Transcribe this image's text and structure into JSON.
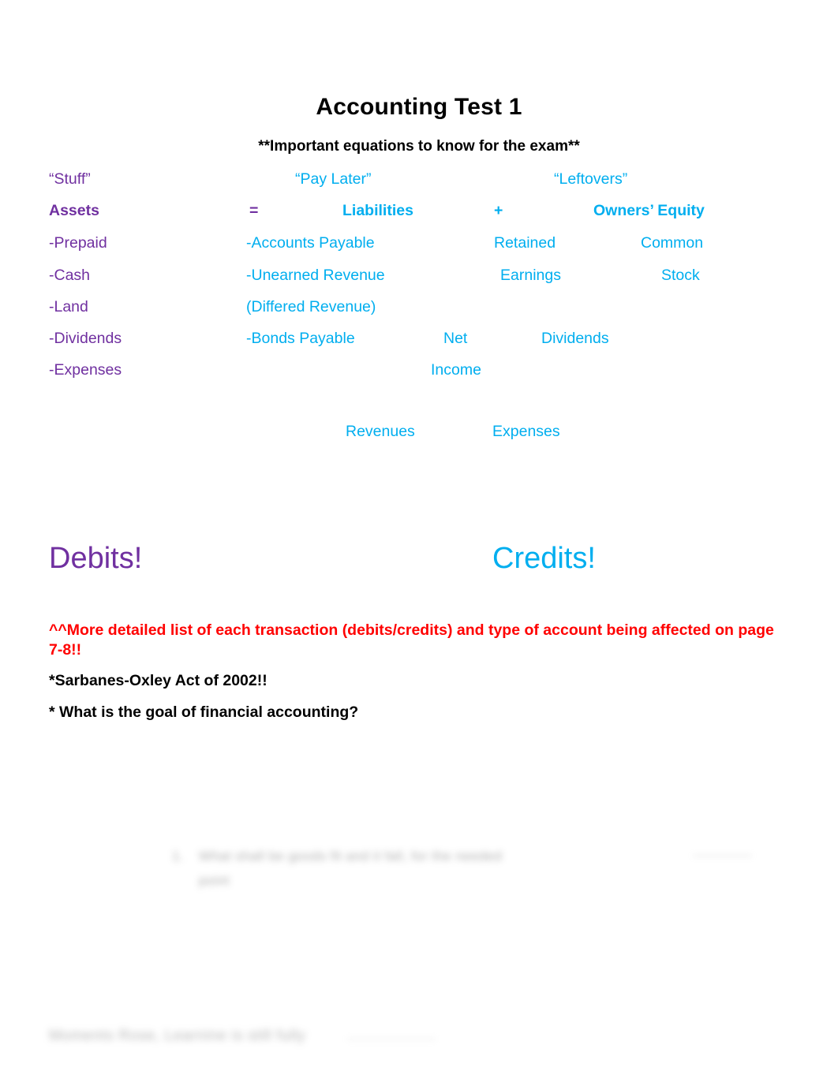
{
  "document": {
    "title": "Accounting Test 1",
    "subtitle": "**Important equations to know for the exam**"
  },
  "equation": {
    "nicknames": {
      "assets": "“Stuff”",
      "liabilities": "“Pay Later”",
      "owners_equity": "“Leftovers”"
    },
    "headers": {
      "assets": "Assets",
      "equals": "=",
      "liabilities": "Liabilities",
      "plus": "+",
      "owners_equity": "Owners’ Equity"
    },
    "assets_items": [
      "-Prepaid",
      "-Cash",
      "-Land",
      "-Dividends",
      "-Expenses"
    ],
    "liabilities_items": [
      "-Accounts Payable",
      "-Unearned Revenue",
      "(Differed Revenue)",
      "-Bonds Payable"
    ],
    "equity_items": {
      "retained": "Retained",
      "earnings": "Earnings",
      "common": "Common",
      "stock": "Stock",
      "net": "Net",
      "income": "Income",
      "dividends": "Dividends",
      "revenues": "Revenues",
      "expenses": "Expenses"
    }
  },
  "headings": {
    "debits": "Debits!",
    "credits": "Credits!"
  },
  "notes": {
    "red_note": "^^More detailed list of each transaction (debits/credits) and type of account being affected on page 7-8!!",
    "sarbanes_oxley": "*Sarbanes-Oxley Act of 2002!!",
    "goal_question": "* What is the goal of financial accounting?"
  },
  "redacted": {
    "list_line_1": "What shall be goods fit and it fall, for the needed",
    "list_line_2": "point",
    "list_marker": "1.",
    "trailing_mark": "—————",
    "footer_line": "Moments Rose, Learnine is still fully",
    "footer_tail": "————————"
  },
  "colors": {
    "purple": "#7030A0",
    "cyan": "#00AEEF",
    "red": "#FF0000",
    "black": "#000000",
    "background": "#FFFFFF"
  }
}
